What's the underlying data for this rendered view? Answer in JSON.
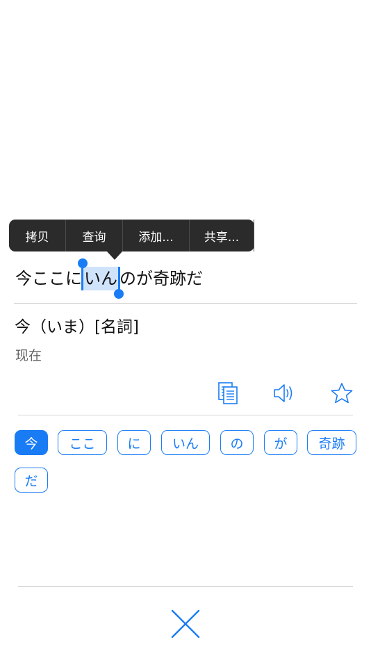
{
  "context_menu": {
    "items": [
      "拷贝",
      "查询",
      "添加...",
      "共享..."
    ]
  },
  "sentence": {
    "before": "今ここに",
    "selected": "いん",
    "after": "のが奇跡だ"
  },
  "entry": {
    "heading": "今（いま）[名詞]",
    "meaning": "现在"
  },
  "actions": {
    "copy_icon": "copy-document-icon",
    "sound_icon": "speaker-icon",
    "favorite_icon": "star-icon"
  },
  "tokens": [
    "今",
    "ここ",
    "に",
    "いん",
    "の",
    "が",
    "奇跡",
    "だ"
  ],
  "active_token": "今",
  "colors": {
    "accent": "#1a7cf5",
    "menu_bg": "#2b2b2b",
    "selection": "#cfe3fb"
  },
  "close_icon": "close-icon"
}
